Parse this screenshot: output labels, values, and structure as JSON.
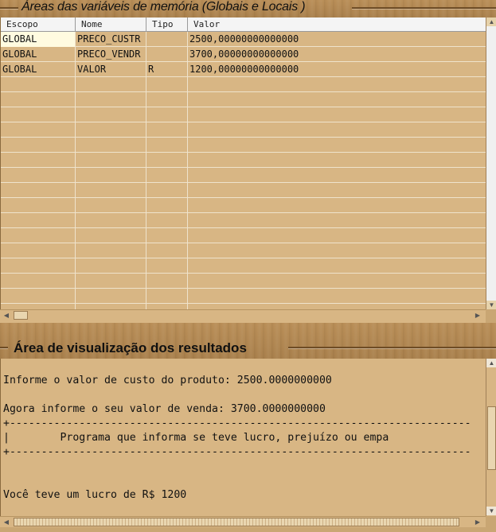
{
  "variables_panel": {
    "title": "Áreas das variáveis de memória (Globais e Locais )",
    "columns": [
      "Escopo",
      "Nome",
      "Tipo",
      "Valor"
    ],
    "rows": [
      {
        "scope": "GLOBAL",
        "name": "PRECO_CUSTR",
        "type": "",
        "value": "2500,00000000000000"
      },
      {
        "scope": "GLOBAL",
        "name": "PRECO_VENDR",
        "type": "",
        "value": "3700,00000000000000"
      },
      {
        "scope": "GLOBAL",
        "name": "VALOR",
        "type": "R",
        "value": "1200,00000000000000"
      }
    ]
  },
  "results_panel": {
    "title": "Área de visualização dos resultados",
    "lines": [
      "",
      "Informe o valor de custo do produto: 2500.0000000000",
      "",
      "Agora informe o seu valor de venda: 3700.0000000000",
      "+-------------------------------------------------------------------------",
      "|        Programa que informa se teve lucro, prejuízo ou empa",
      "+-------------------------------------------------------------------------",
      "",
      "",
      "Você teve um lucro de R$ 1200"
    ]
  },
  "icons": {
    "scroll_up": "up-arrow-icon",
    "scroll_down": "down-arrow-icon",
    "scroll_left": "left-arrow-icon",
    "scroll_right": "right-arrow-icon"
  },
  "colors": {
    "panel_background": "#d8b684",
    "wood": "#b98e57",
    "header_background": "#f4f4f4",
    "selected_cell": "#fffbe0"
  }
}
